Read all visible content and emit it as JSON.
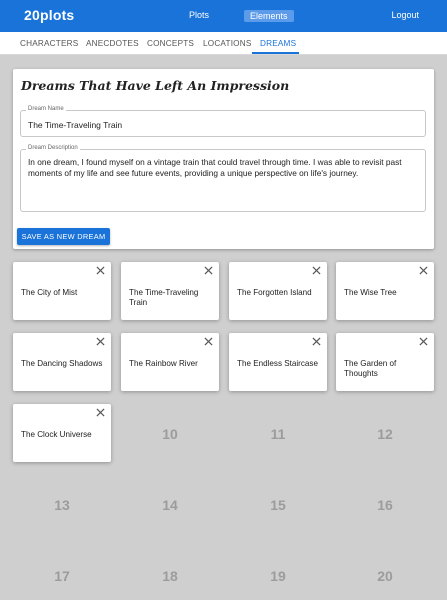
{
  "appbar": {
    "brand": "20plots",
    "links": {
      "plots": "Plots",
      "elements": "Elements",
      "logout": "Logout"
    }
  },
  "tabs": [
    "CHARACTERS",
    "ANECDOTES",
    "CONCEPTS",
    "LOCATIONS",
    "DREAMS"
  ],
  "active_tab": "DREAMS",
  "form": {
    "title": "Dreams That Have Left An Impression",
    "name_label": "Dream Name",
    "name_value": "The Time-Traveling Train",
    "desc_label": "Dream Description",
    "desc_value": "In one dream, I found myself on a vintage train that could travel through time. I was able to revisit past moments of my life and see future events, providing a unique perspective on life's journey.",
    "save_label": "SAVE AS NEW DREAM"
  },
  "dreams": [
    {
      "title": "The City of Mist"
    },
    {
      "title": "The Time-Traveling Train"
    },
    {
      "title": "The Forgotten Island"
    },
    {
      "title": "The Wise Tree"
    },
    {
      "title": "The Dancing Shadows"
    },
    {
      "title": "The Rainbow River"
    },
    {
      "title": "The Endless Staircase"
    },
    {
      "title": "The Garden of Thoughts"
    },
    {
      "title": "The Clock Universe"
    }
  ],
  "empty_slots": [
    "10",
    "11",
    "12",
    "13",
    "14",
    "15",
    "16",
    "17",
    "18",
    "19",
    "20"
  ],
  "icons": {
    "close": "close-icon"
  },
  "colors": {
    "primary": "#1a73d9",
    "background": "#cfcfcf"
  }
}
